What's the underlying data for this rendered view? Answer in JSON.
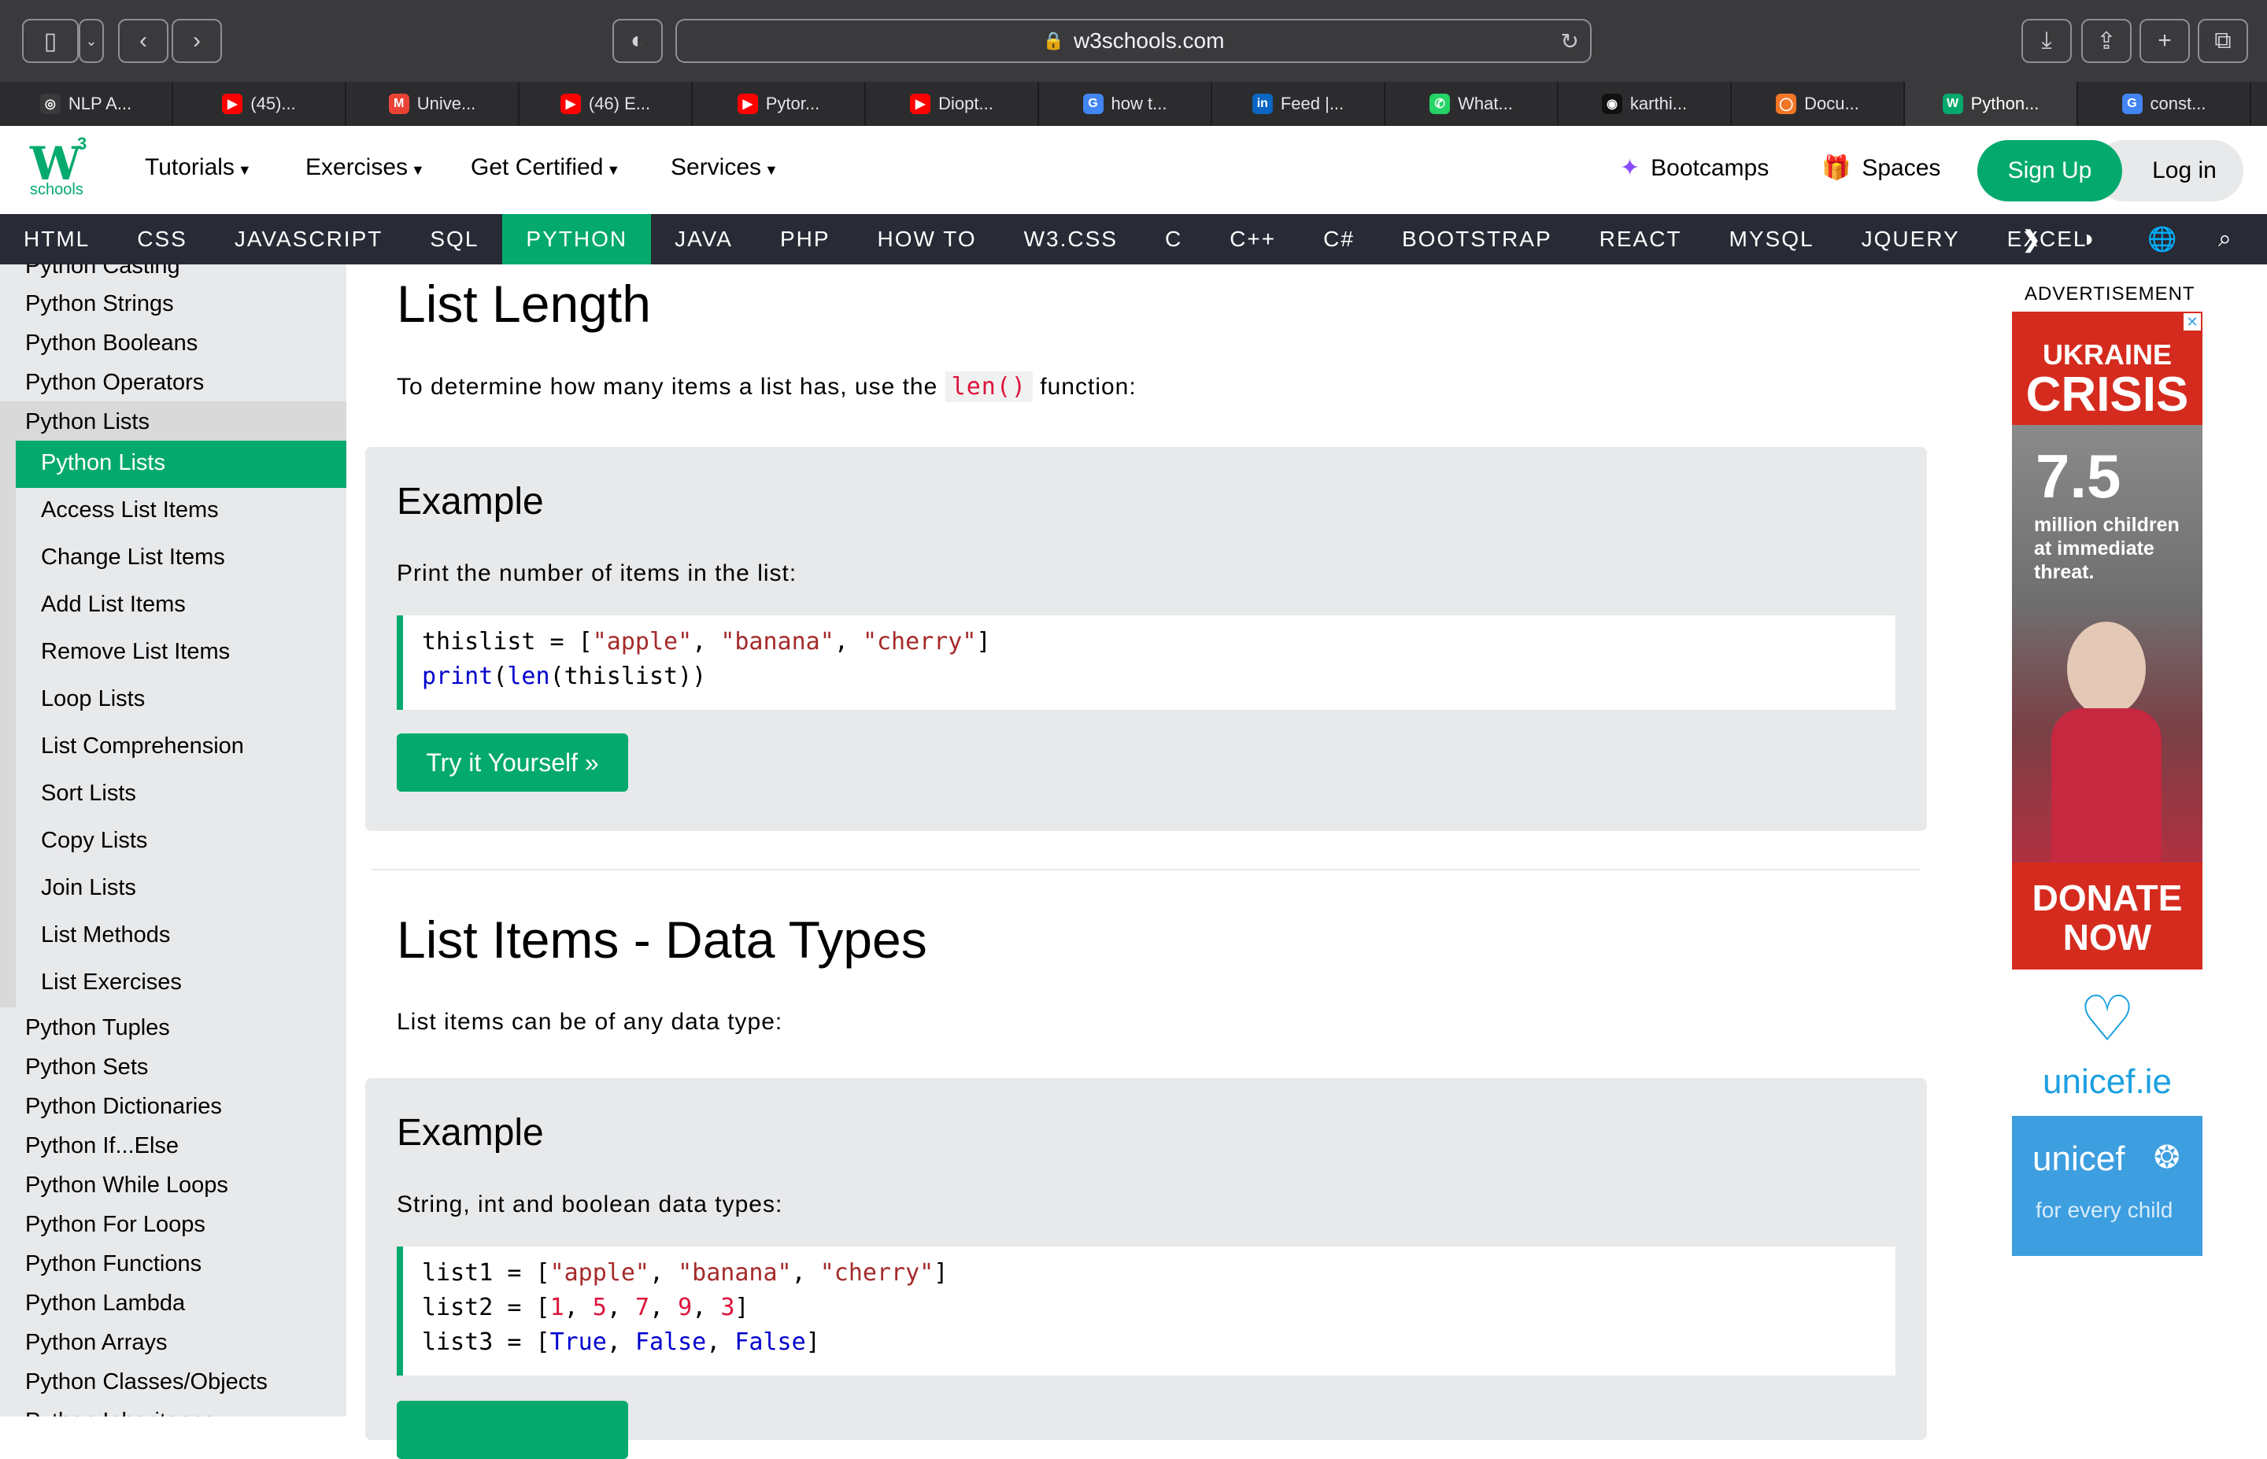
{
  "browser": {
    "url": "w3schools.com",
    "tabs": [
      {
        "label": "NLP A...",
        "fav": "◎",
        "color": "#3a3a3c"
      },
      {
        "label": "(45)...",
        "fav": "▶",
        "color": "#ff0000"
      },
      {
        "label": "Unive...",
        "fav": "M",
        "color": "#ea4335"
      },
      {
        "label": "(46) E...",
        "fav": "▶",
        "color": "#ff0000"
      },
      {
        "label": "Pytor...",
        "fav": "▶",
        "color": "#ff0000"
      },
      {
        "label": "Diopt...",
        "fav": "▶",
        "color": "#ff0000"
      },
      {
        "label": "how t...",
        "fav": "G",
        "color": "#4285f4"
      },
      {
        "label": "Feed |...",
        "fav": "in",
        "color": "#0a66c2"
      },
      {
        "label": "What...",
        "fav": "✆",
        "color": "#25d366"
      },
      {
        "label": "karthi...",
        "fav": "◉",
        "color": "#111"
      },
      {
        "label": "Docu...",
        "fav": "◯",
        "color": "#f37626"
      },
      {
        "label": "Python...",
        "fav": "W",
        "color": "#04aa6d"
      },
      {
        "label": "const...",
        "fav": "G",
        "color": "#4285f4"
      }
    ]
  },
  "logo": {
    "w": "W",
    "three": "3",
    "schools": "schools"
  },
  "topnav": {
    "tutorials": "Tutorials",
    "exercises": "Exercises",
    "certified": "Get Certified",
    "services": "Services",
    "bootcamps": "Bootcamps",
    "spaces": "Spaces",
    "signup": "Sign Up",
    "login": "Log in"
  },
  "subnav": [
    "HTML",
    "CSS",
    "JAVASCRIPT",
    "SQL",
    "PYTHON",
    "JAVA",
    "PHP",
    "HOW TO",
    "W3.CSS",
    "C",
    "C++",
    "C#",
    "BOOTSTRAP",
    "REACT",
    "MYSQL",
    "JQUERY",
    "EXCEL"
  ],
  "sidebar": {
    "top": [
      "Python Casting",
      "Python Strings",
      "Python Booleans",
      "Python Operators",
      "Python Lists"
    ],
    "sub": [
      "Python Lists",
      "Access List Items",
      "Change List Items",
      "Add List Items",
      "Remove List Items",
      "Loop Lists",
      "List Comprehension",
      "Sort Lists",
      "Copy Lists",
      "Join Lists",
      "List Methods",
      "List Exercises"
    ],
    "bottom": [
      "Python Tuples",
      "Python Sets",
      "Python Dictionaries",
      "Python If...Else",
      "Python While Loops",
      "Python For Loops",
      "Python Functions",
      "Python Lambda",
      "Python Arrays",
      "Python Classes/Objects",
      "Python Inheritance"
    ]
  },
  "main": {
    "section1": {
      "title": "List Length",
      "text_before": "To determine how many items a list has, use the ",
      "code": "len()",
      "text_after": " function:",
      "example_title": "Example",
      "example_desc": "Print the number of items in the list:",
      "try_label": "Try it Yourself »"
    },
    "section2": {
      "title": "List Items - Data Types",
      "text": "List items can be of any data type:",
      "example_title": "Example",
      "example_desc": "String, int and boolean data types:"
    }
  },
  "ad": {
    "label": "ADVERTISEMENT",
    "headline1": "UKRAINE",
    "headline2": "CRISIS",
    "stat": "7.5",
    "stat_text": "million children at immediate threat.",
    "donate1": "DONATE",
    "donate2": "NOW",
    "site": "unicef.ie",
    "brand": "unicef",
    "tagline": "for every child"
  }
}
